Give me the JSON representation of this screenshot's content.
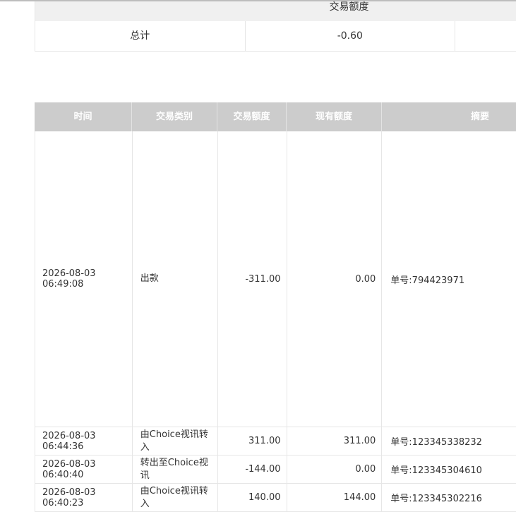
{
  "summary": {
    "header": "交易额度",
    "total_label": "总计",
    "total_value": "-0.60"
  },
  "detail": {
    "columns": [
      "时间",
      "交易类别",
      "交易额度",
      "现有额度",
      "摘要"
    ],
    "rows": [
      {
        "time": "2026-08-03 06:49:08",
        "type": "出款",
        "amount": "-311.00",
        "balance": "0.00",
        "memo": "单号:794423971"
      },
      {
        "time": "2026-08-03 06:44:36",
        "type": "由Choice视讯转入",
        "amount": "311.00",
        "balance": "311.00",
        "memo": "单号:123345338232"
      },
      {
        "time": "2026-08-03 06:40:40",
        "type": "转出至Choice视讯",
        "amount": "-144.00",
        "balance": "0.00",
        "memo": "单号:123345304610"
      },
      {
        "time": "2026-08-03 06:40:23",
        "type": "由Choice视讯转入",
        "amount": "140.00",
        "balance": "144.00",
        "memo": "单号:123345302216"
      }
    ]
  }
}
